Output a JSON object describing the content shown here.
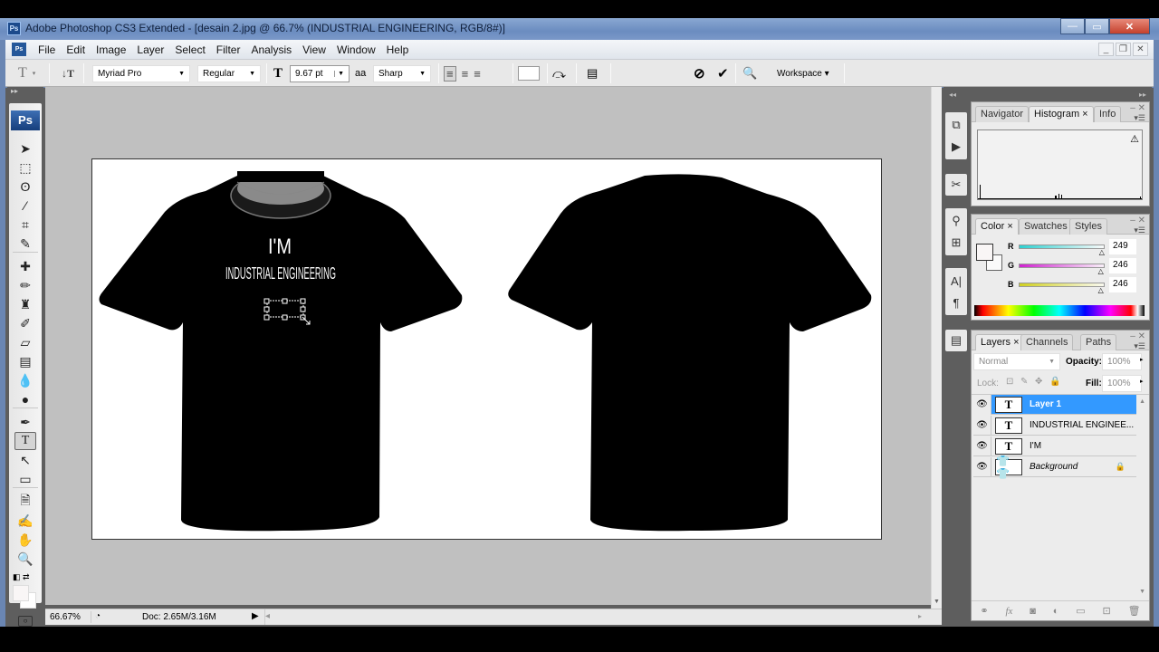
{
  "window": {
    "title": "Adobe Photoshop CS3 Extended - [desain 2.jpg @ 66.7% (INDUSTRIAL ENGINEERING, RGB/8#)]",
    "app_icon": "Ps",
    "minimize": "—",
    "maximize": "▭",
    "close": "✕"
  },
  "menubar": {
    "items": [
      "File",
      "Edit",
      "Image",
      "Layer",
      "Select",
      "Filter",
      "Analysis",
      "View",
      "Window",
      "Help"
    ],
    "doc_minimize": "_",
    "doc_restore": "❐",
    "doc_close": "✕"
  },
  "options": {
    "tool_glyph": "T",
    "orientation_glyph": "↓T",
    "font_family": "Myriad Pro",
    "font_style": "Regular",
    "font_size": "9.67 pt",
    "size_glyph": "T",
    "aa_glyph": "aa",
    "antialias": "Sharp",
    "cancel_glyph": "⊘",
    "commit_glyph": "✔",
    "workspace_label": "Workspace ▾"
  },
  "toolbox": {
    "badge": "Ps",
    "collapse": "▸▸",
    "tools": [
      {
        "name": "move-tool",
        "glyph": "➤"
      },
      {
        "name": "marquee-tool",
        "glyph": "⬚"
      },
      {
        "name": "lasso-tool",
        "glyph": "ʘ"
      },
      {
        "name": "quick-selection-tool",
        "glyph": "⁄"
      },
      {
        "name": "crop-tool",
        "glyph": "⌗"
      },
      {
        "name": "slice-tool",
        "glyph": "✎"
      },
      {
        "name": "healing-brush-tool",
        "glyph": "✚"
      },
      {
        "name": "brush-tool",
        "glyph": "✏"
      },
      {
        "name": "clone-stamp-tool",
        "glyph": "♜"
      },
      {
        "name": "history-brush-tool",
        "glyph": "✐"
      },
      {
        "name": "eraser-tool",
        "glyph": "▱"
      },
      {
        "name": "gradient-tool",
        "glyph": "▤"
      },
      {
        "name": "blur-tool",
        "glyph": "💧"
      },
      {
        "name": "dodge-tool",
        "glyph": "●"
      },
      {
        "name": "pen-tool",
        "glyph": "✒"
      },
      {
        "name": "type-tool",
        "glyph": "T"
      },
      {
        "name": "path-selection-tool",
        "glyph": "↖"
      },
      {
        "name": "shape-tool",
        "glyph": "▭"
      },
      {
        "name": "notes-tool",
        "glyph": "🗎"
      },
      {
        "name": "eyedropper-tool",
        "glyph": "✍"
      },
      {
        "name": "hand-tool",
        "glyph": "✋"
      },
      {
        "name": "zoom-tool",
        "glyph": "🔍"
      }
    ]
  },
  "canvas": {
    "front_line1": "I'M",
    "front_line2": "INDUSTRIAL ENGINEERING"
  },
  "statusbar": {
    "zoom": "66.67%",
    "doc_info": "Doc: 2.65M/3.16M",
    "arrow": "▶",
    "left_arrow": "◂"
  },
  "histogram_panel": {
    "tabs": [
      "Navigator",
      "Histogram ×",
      "Info"
    ],
    "active_tab": 1,
    "warning": "⚠"
  },
  "color_panel": {
    "tabs": [
      "Color ×",
      "Swatches",
      "Styles"
    ],
    "active_tab": 0,
    "channels": [
      {
        "label": "R",
        "value": "249",
        "level": 0.976
      },
      {
        "label": "G",
        "value": "246",
        "level": 0.965
      },
      {
        "label": "B",
        "value": "246",
        "level": 0.965
      }
    ]
  },
  "layers_panel": {
    "tabs": [
      "Layers ×",
      "Channels",
      "Paths"
    ],
    "active_tab": 0,
    "blend_mode": "Normal",
    "opacity_label": "Opacity:",
    "opacity": "100%",
    "lock_label": "Lock:",
    "fill_label": "Fill:",
    "fill": "100%",
    "layers": [
      {
        "name": "Layer 1",
        "thumb": "T",
        "selected": true
      },
      {
        "name": "INDUSTRIAL ENGINEE...",
        "thumb": "T",
        "selected": false
      },
      {
        "name": "I'M",
        "thumb": "T",
        "selected": false
      },
      {
        "name": "Background",
        "thumb": "shirts",
        "selected": false,
        "locked": true
      }
    ],
    "footer_icons": [
      "link-icon",
      "fx-icon",
      "mask-icon",
      "adjustment-icon",
      "group-icon",
      "new-layer-icon",
      "trash-icon"
    ]
  },
  "colors": {
    "accent_selected": "#3399ff",
    "workspace_dark": "#5e5e5e",
    "canvas_bg": "#c0c0c0"
  }
}
